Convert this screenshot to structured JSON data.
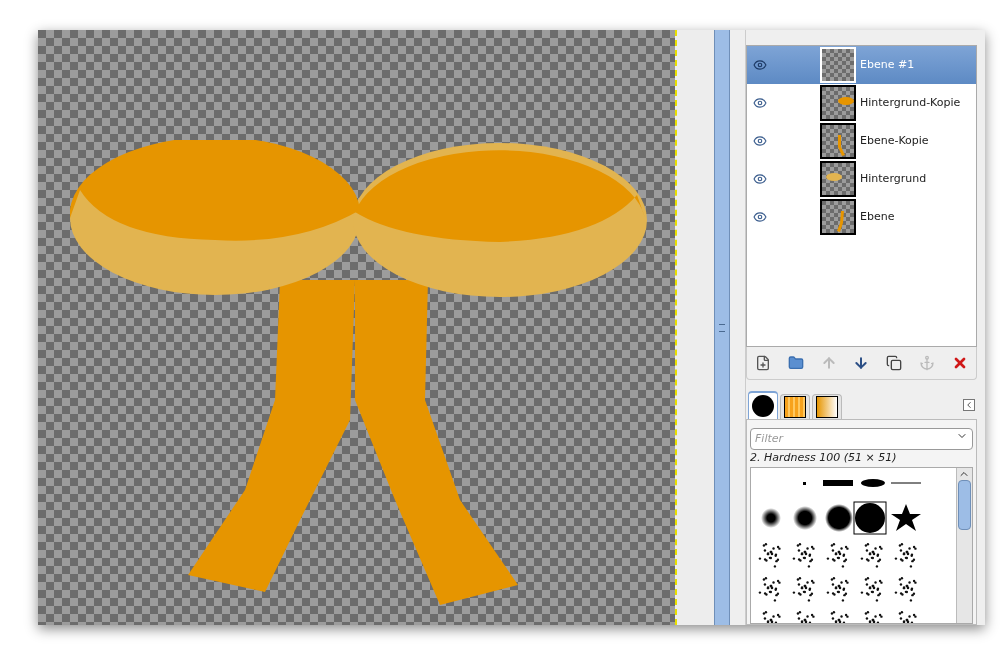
{
  "layers": [
    {
      "name": "Ebene #1",
      "visible": true,
      "selected": true,
      "kind": "empty"
    },
    {
      "name": "Hintergrund-Kopie",
      "visible": true,
      "selected": false,
      "kind": "loop-right"
    },
    {
      "name": "Ebene-Kopie",
      "visible": true,
      "selected": false,
      "kind": "tail-left"
    },
    {
      "name": "Hintergrund",
      "visible": true,
      "selected": false,
      "kind": "loop-left"
    },
    {
      "name": "Ebene",
      "visible": true,
      "selected": false,
      "kind": "tail-right"
    }
  ],
  "layer_buttons": [
    {
      "kind": "new",
      "disabled": false
    },
    {
      "kind": "group",
      "disabled": false
    },
    {
      "kind": "raise",
      "disabled": true
    },
    {
      "kind": "lower",
      "disabled": false
    },
    {
      "kind": "duplicate",
      "disabled": false
    },
    {
      "kind": "anchor",
      "disabled": true
    },
    {
      "kind": "delete",
      "disabled": false
    }
  ],
  "brush_tabs": [
    {
      "kind": "brush",
      "selected": true
    },
    {
      "kind": "pattern",
      "selected": false
    },
    {
      "kind": "gradient",
      "selected": false
    }
  ],
  "filter": {
    "placeholder": "Filter"
  },
  "brush_name": "2. Hardness 100 (51 × 51)"
}
